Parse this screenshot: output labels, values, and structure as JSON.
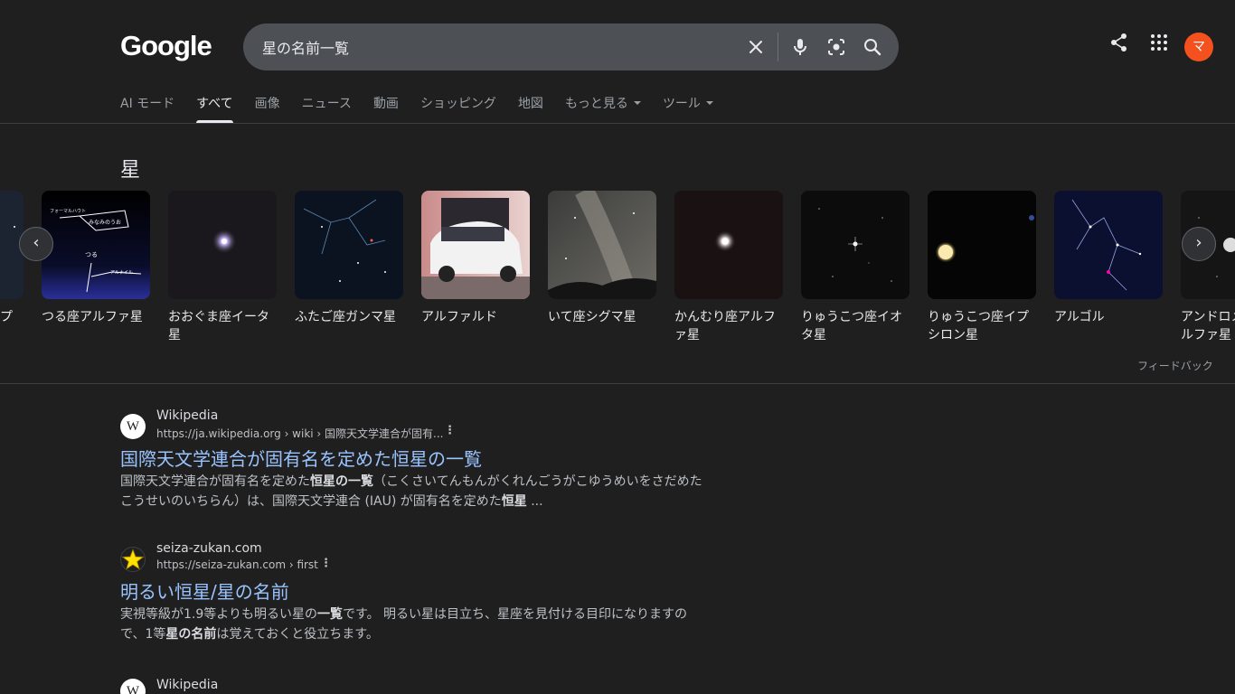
{
  "header": {
    "logo": "Google",
    "search_value": "星の名前一覧",
    "avatar_letter": "マ"
  },
  "tabs": [
    {
      "label": "AI モード",
      "active": false
    },
    {
      "label": "すべて",
      "active": true
    },
    {
      "label": "画像",
      "active": false
    },
    {
      "label": "ニュース",
      "active": false
    },
    {
      "label": "動画",
      "active": false
    },
    {
      "label": "ショッピング",
      "active": false
    },
    {
      "label": "地図",
      "active": false
    },
    {
      "label": "もっと見る",
      "active": false,
      "dropdown": true
    },
    {
      "label": "ツール",
      "active": false,
      "dropdown": true
    }
  ],
  "stars_section": {
    "title": "星",
    "feedback": "フィードバック",
    "items": [
      {
        "label": "プ"
      },
      {
        "label": "つる座アルファ星"
      },
      {
        "label": "おおぐま座イータ星"
      },
      {
        "label": "ふたご座ガンマ星"
      },
      {
        "label": "アルファルド"
      },
      {
        "label": "いて座シグマ星"
      },
      {
        "label": "かんむり座アルファ星"
      },
      {
        "label": "りゅうこつ座イオタ星"
      },
      {
        "label": "りゅうこつ座イプシロン星"
      },
      {
        "label": "アルゴル"
      },
      {
        "label": "アンドロメダ座アルファ星"
      }
    ],
    "thumb_texts": {
      "tsuru_top": "みなみのうお",
      "tsuru_left": "フォーマルハウト",
      "tsuru_mid": "つる",
      "tsuru_right": "アルナイル"
    }
  },
  "results": [
    {
      "favicon": "W",
      "site": "Wikipedia",
      "url": "https://ja.wikipedia.org › wiki › 国際天文学連合が固有...",
      "title": "国際天文学連合が固有名を定めた恒星の一覧",
      "snippet_parts": [
        "国際天文学連合が固有名を定めた",
        "恒星の一覧",
        "（こくさいてんもんがくれんごうがこゆうめいをさだめたこうせいのいちらん）は、国際天文学連合 (IAU) が固有名を定めた",
        "恒星",
        " ..."
      ]
    },
    {
      "favicon": "★",
      "site": "seiza-zukan.com",
      "url": "https://seiza-zukan.com › first",
      "title": "明るい恒星/星の名前",
      "snippet_parts": [
        "実視等級が1.9等よりも明るい星の",
        "一覧",
        "です。 明るい星は目立ち、星座を見付ける目印になりますので、1等",
        "星の名前",
        "は覚えておくと役立ちます。"
      ]
    },
    {
      "favicon": "W",
      "site": "Wikipedia"
    }
  ]
}
